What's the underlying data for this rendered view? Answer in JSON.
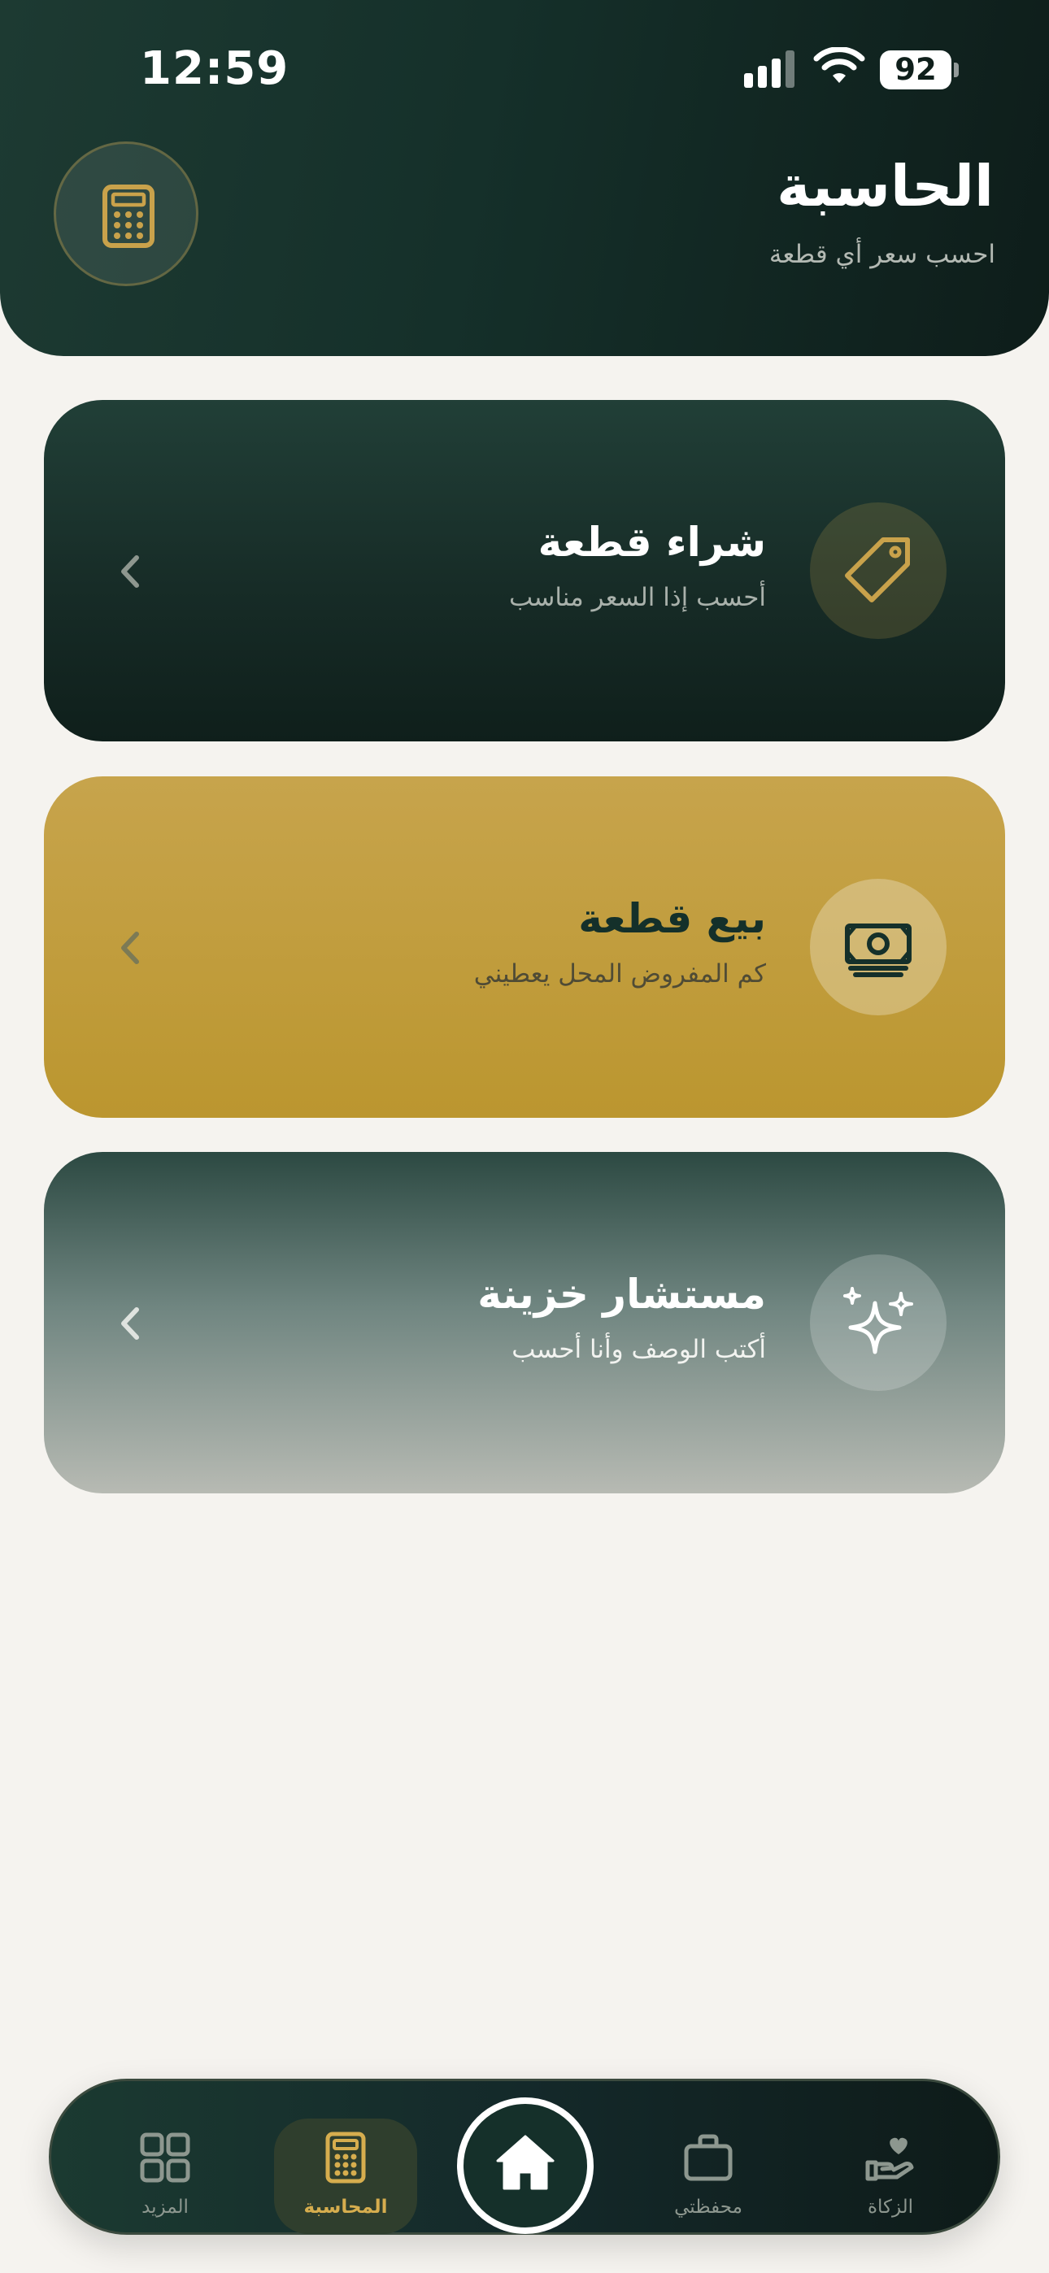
{
  "status_bar": {
    "time": "12:59",
    "battery": "92",
    "icons": [
      "signal-icon",
      "wifi-icon",
      "battery-icon"
    ]
  },
  "header": {
    "title": "الحاسبة",
    "subtitle": "احسب سعر أي قطعة",
    "icon": "calculator-icon"
  },
  "cards": [
    {
      "title": "شراء قطعة",
      "subtitle": "أحسب إذا السعر مناسب",
      "icon": "tag-icon",
      "chevron": "chevron-left-icon"
    },
    {
      "title": "بيع قطعة",
      "subtitle": "كم المفروض المحل يعطيني",
      "icon": "cash-icon",
      "chevron": "chevron-left-icon"
    },
    {
      "title": "مستشار خزينة",
      "subtitle": "أكتب الوصف وأنا أحسب",
      "icon": "sparkles-icon",
      "chevron": "chevron-left-icon"
    }
  ],
  "bottom_nav": {
    "active": "المحاسبة",
    "items": [
      {
        "label": "المزيد",
        "icon": "grid-icon"
      },
      {
        "label": "المحاسبة",
        "icon": "calculator-icon"
      },
      {
        "label": "",
        "icon": "home-icon"
      },
      {
        "label": "محفظتي",
        "icon": "briefcase-icon"
      },
      {
        "label": "الزكاة",
        "icon": "hand-heart-icon"
      }
    ]
  },
  "colors": {
    "dark_green": "#15302a",
    "gold": "#c6a04a",
    "background": "#f5f3ef"
  }
}
